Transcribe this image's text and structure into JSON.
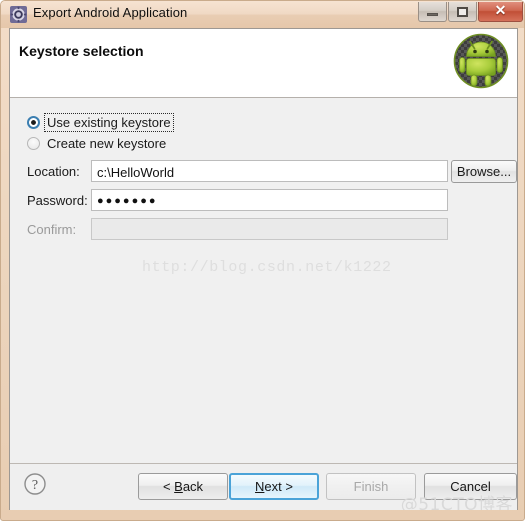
{
  "window": {
    "title": "Export Android Application",
    "app_icon": "eclipse-export-icon",
    "controls": {
      "minimize": "minimize-button",
      "maximize": "maximize-button",
      "close": "close-button",
      "close_glyph": "✕"
    }
  },
  "header": {
    "title": "Keystore selection",
    "logo": "android-robot-logo"
  },
  "content": {
    "radios": [
      {
        "label": "Use existing keystore",
        "selected": true,
        "focused": true
      },
      {
        "label": "Create new keystore",
        "selected": false,
        "focused": false
      }
    ],
    "fields": [
      {
        "label": "Location:",
        "value": "c:\\HelloWorld",
        "disabled": false,
        "masked": false
      },
      {
        "label": "Password:",
        "value": "●●●●●●●",
        "disabled": false,
        "masked": true
      },
      {
        "label": "Confirm:",
        "value": "",
        "disabled": true,
        "masked": true
      }
    ],
    "browse_label": "Browse...",
    "watermark_url": "http://blog.csdn.net/k1222"
  },
  "footer": {
    "help_glyph": "?",
    "buttons": [
      {
        "label": "< Back",
        "state": "enabled",
        "default": false
      },
      {
        "label": "Next >",
        "state": "enabled",
        "default": true
      },
      {
        "label": "Finish",
        "state": "disabled",
        "default": false
      },
      {
        "label": "Cancel",
        "state": "enabled",
        "default": false
      }
    ],
    "watermark_brand": "@51CTO博客"
  },
  "colors": {
    "frame": "#e8cdb2",
    "accent_blue": "#4aa3d8",
    "android_green": "#a4c639",
    "close_red": "#c14f36",
    "body_bg": "#f0f0f0"
  }
}
